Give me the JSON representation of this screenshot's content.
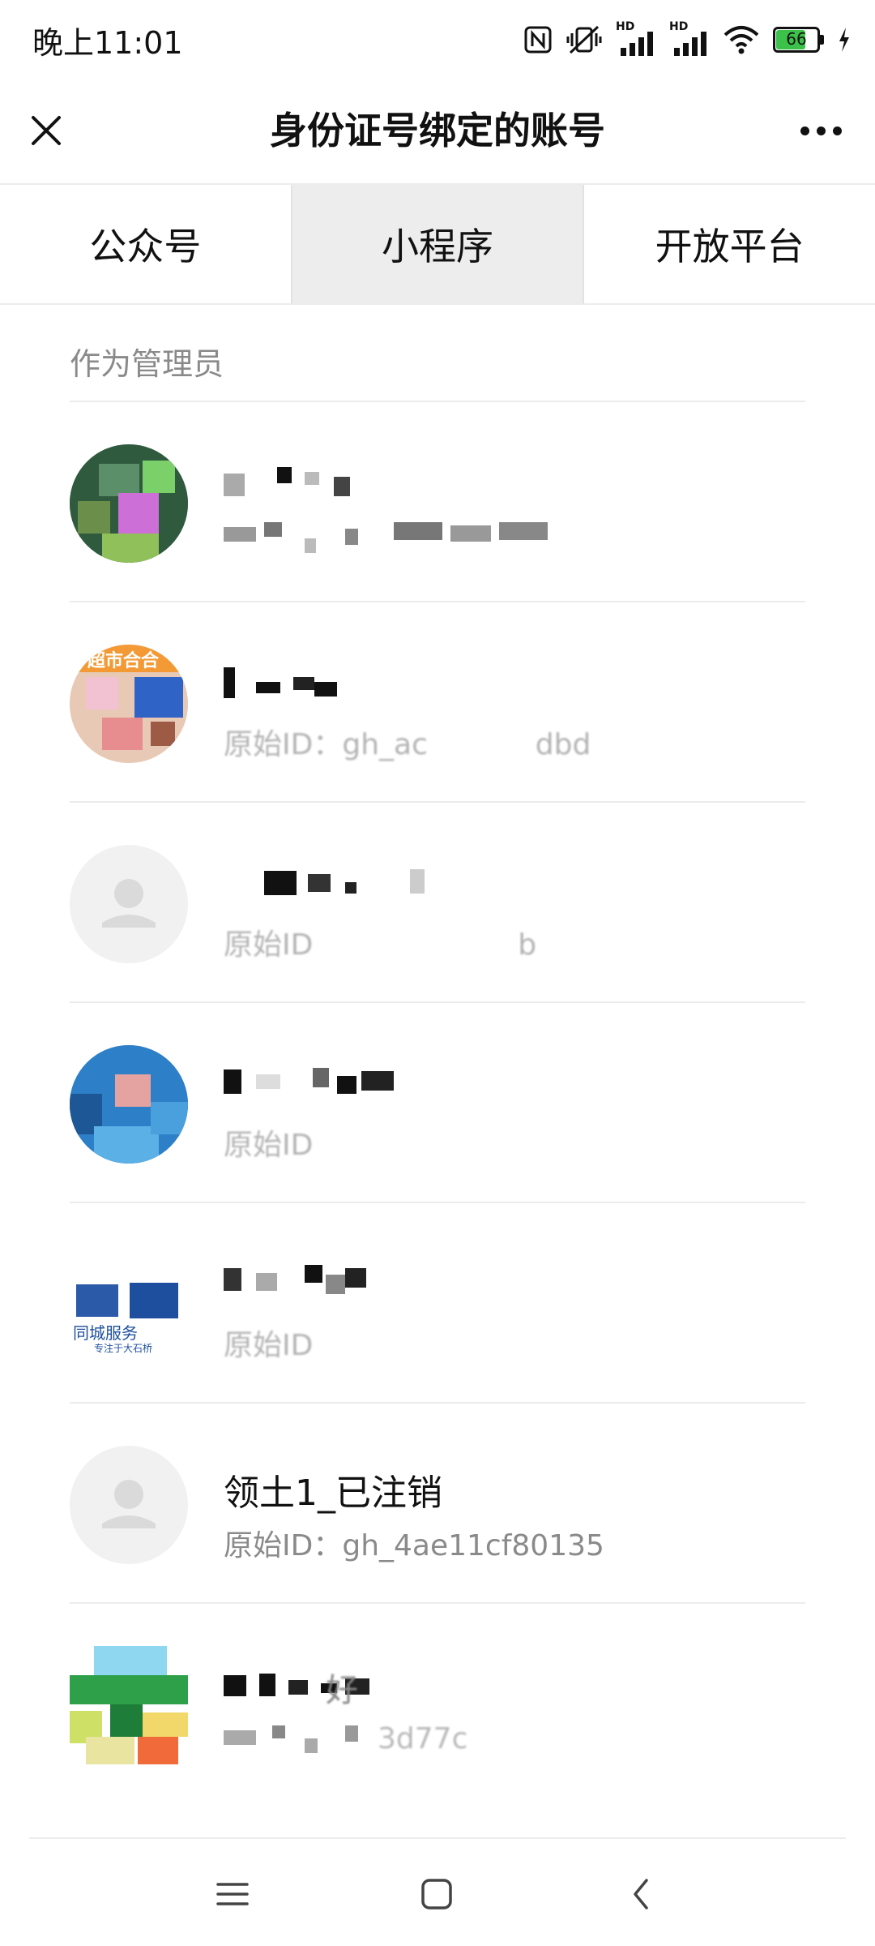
{
  "status_bar": {
    "time": "晚上11:01",
    "hd_label_1": "HD",
    "hd_label_2": "HD",
    "battery_level": "66",
    "icons": [
      "nfc-icon",
      "vibrate-off-icon",
      "signal-icon",
      "signal-icon",
      "wifi-icon",
      "battery-icon",
      "charging-icon"
    ]
  },
  "header": {
    "title": "身份证号绑定的账号",
    "close_icon": "close-icon",
    "more_icon": "more-icon"
  },
  "tabs": [
    {
      "label": "公众号",
      "active": false
    },
    {
      "label": "小程序",
      "active": true
    },
    {
      "label": "开放平台",
      "active": false
    }
  ],
  "section": {
    "title": "作为管理员"
  },
  "accounts": [
    {
      "name": "",
      "id_text": "",
      "avatar": "pixelated"
    },
    {
      "name": "",
      "id_text": "原始ID：gh_ac",
      "id_suffix": "dbd",
      "avatar_text": "超市合合"
    },
    {
      "name": "",
      "id_text": "原始ID",
      "id_suffix": "b",
      "avatar": "default"
    },
    {
      "name": "",
      "id_text": "原始ID",
      "avatar": "pixelated"
    },
    {
      "name": "",
      "id_text": "原始ID",
      "avatar_text_1": "同城服务",
      "avatar_text_2": "专注于大石桥"
    },
    {
      "name": "领土1_已注销",
      "id_text": "原始ID：gh_4ae11cf80135",
      "avatar": "default"
    },
    {
      "name": "",
      "id_text": "",
      "name_suffix": "好",
      "id_suffix": "3d77c",
      "avatar": "pixelated"
    }
  ],
  "nav_bar": {
    "menu_icon": "menu-icon",
    "home_icon": "home-icon",
    "back_icon": "back-icon"
  }
}
